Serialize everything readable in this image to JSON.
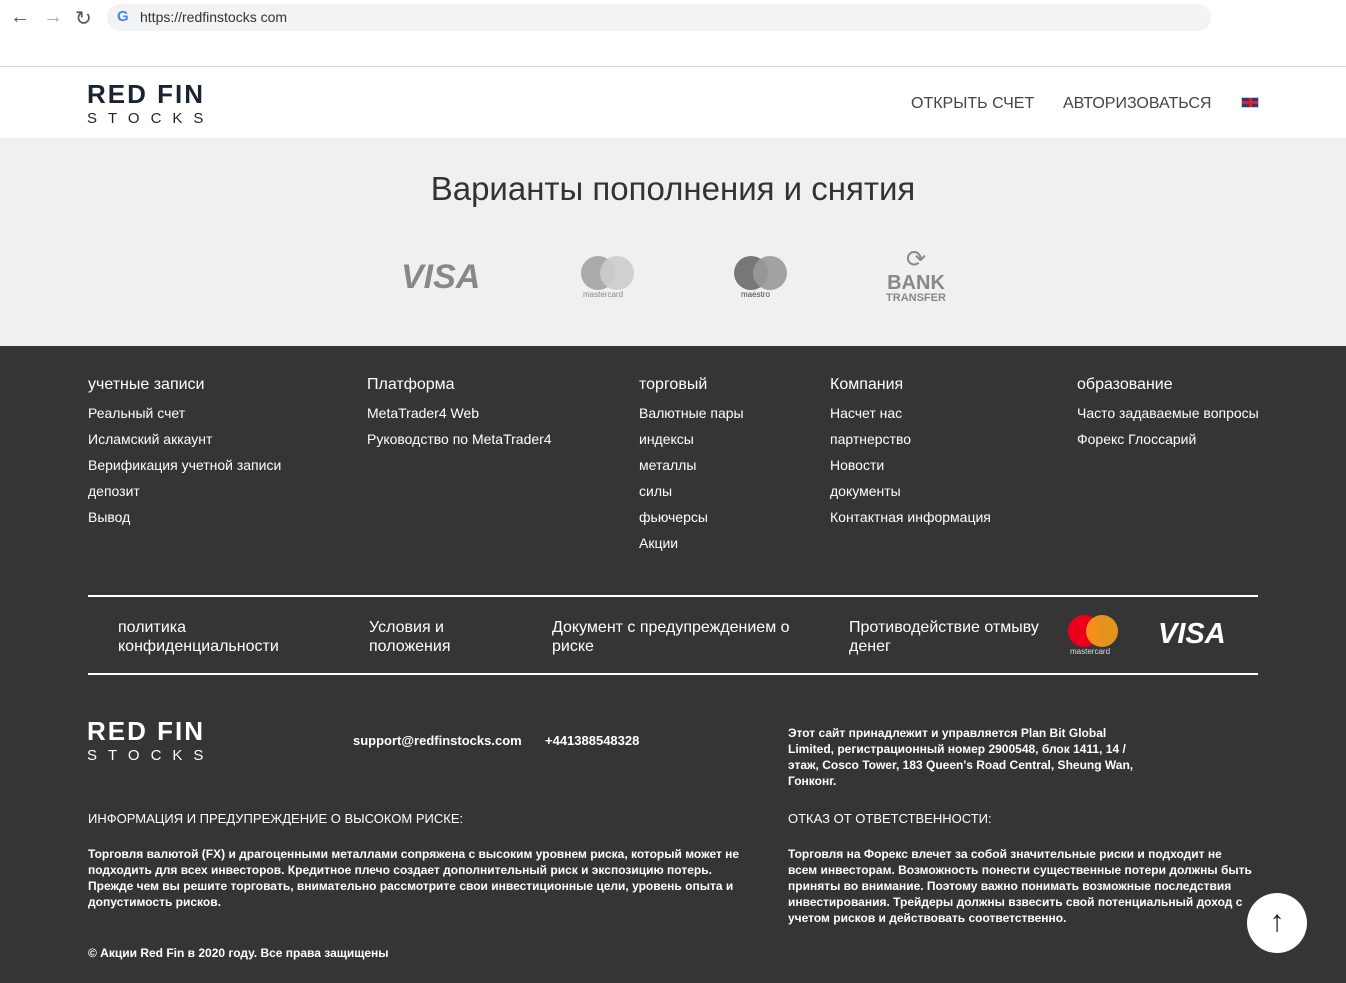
{
  "browser": {
    "url": "https://redfinstocks com"
  },
  "logo": {
    "line1": "RED FIN",
    "line2": "STOCKS"
  },
  "header": {
    "open_account": "ОТКРЫТЬ СЧЕТ",
    "login": "АВТОРИЗОВАТЬСЯ",
    "lang_flag": "uk-flag-icon"
  },
  "payments": {
    "title": "Варианты пополнения и снятия",
    "visa": "VISA",
    "mastercard": "mastercard",
    "maestro": "maestro",
    "bank1": "BANK",
    "bank2": "TRANSFER"
  },
  "footer": {
    "columns": [
      {
        "title": "учетные записи",
        "items": [
          "Реальный счет",
          "Исламский аккаунт",
          "Верификация учетной записи",
          "депозит",
          "Вывод"
        ]
      },
      {
        "title": "Платформа",
        "items": [
          "MetaTrader4 Web",
          "Руководство по MetaTrader4"
        ]
      },
      {
        "title": "торговый",
        "items": [
          "Валютные пары",
          "индексы",
          "металлы",
          "силы",
          "фьючерсы",
          "Акции"
        ]
      },
      {
        "title": "Компания",
        "items": [
          "Насчет нас",
          "партнерство",
          "Новости",
          "документы",
          "Контактная информация"
        ]
      },
      {
        "title": "образование",
        "items": [
          "Часто задаваемые вопросы",
          "Форекс Глоссарий"
        ]
      }
    ],
    "links": [
      "политика конфиденциальности",
      "Условия и положения",
      "Документ с предупреждением о риске",
      "Противодействие отмыву денег"
    ],
    "mastercard": "mastercard",
    "visa": "VISA",
    "email": "support@redfinstocks.com",
    "phone": "+441388548328",
    "company": "Этот сайт принадлежит и управляется Plan Bit Global Limited, регистрационный номер 2900548, блок 1411, 14 / этаж, Cosco Tower, 183 Queen's Road Central, Sheung Wan, Гонконг.",
    "risk_title": "ИНФОРМАЦИЯ И ПРЕДУПРЕЖДЕНИЕ О ВЫСОКОМ РИСКЕ:",
    "risk_text": "Торговля валютой (FX) и драгоценными металлами сопряжена с высоким уровнем риска, который может не подходить для всех инвесторов. Кредитное плечо создает дополнительный риск и экспозицию потерь. Прежде чем вы решите торговать, внимательно рассмотрите свои инвестиционные цели, уровень опыта и допустимость рисков.",
    "disclaimer_title": "ОТКАЗ ОТ ОТВЕТСТВЕННОСТИ:",
    "disclaimer_text": "Торговля на Форекс влечет за собой значительные риски и подходит не всем инвесторам. Возможность понести существенные потери должны быть приняты во внимание. Поэтому важно понимать возможные последствия инвестирования. Трейдеры должны взвесить свой потенциальный доход с учетом рисков и действовать соответственно.",
    "copyright": "© Акции Red Fin в 2020 году. Все права защищены"
  }
}
